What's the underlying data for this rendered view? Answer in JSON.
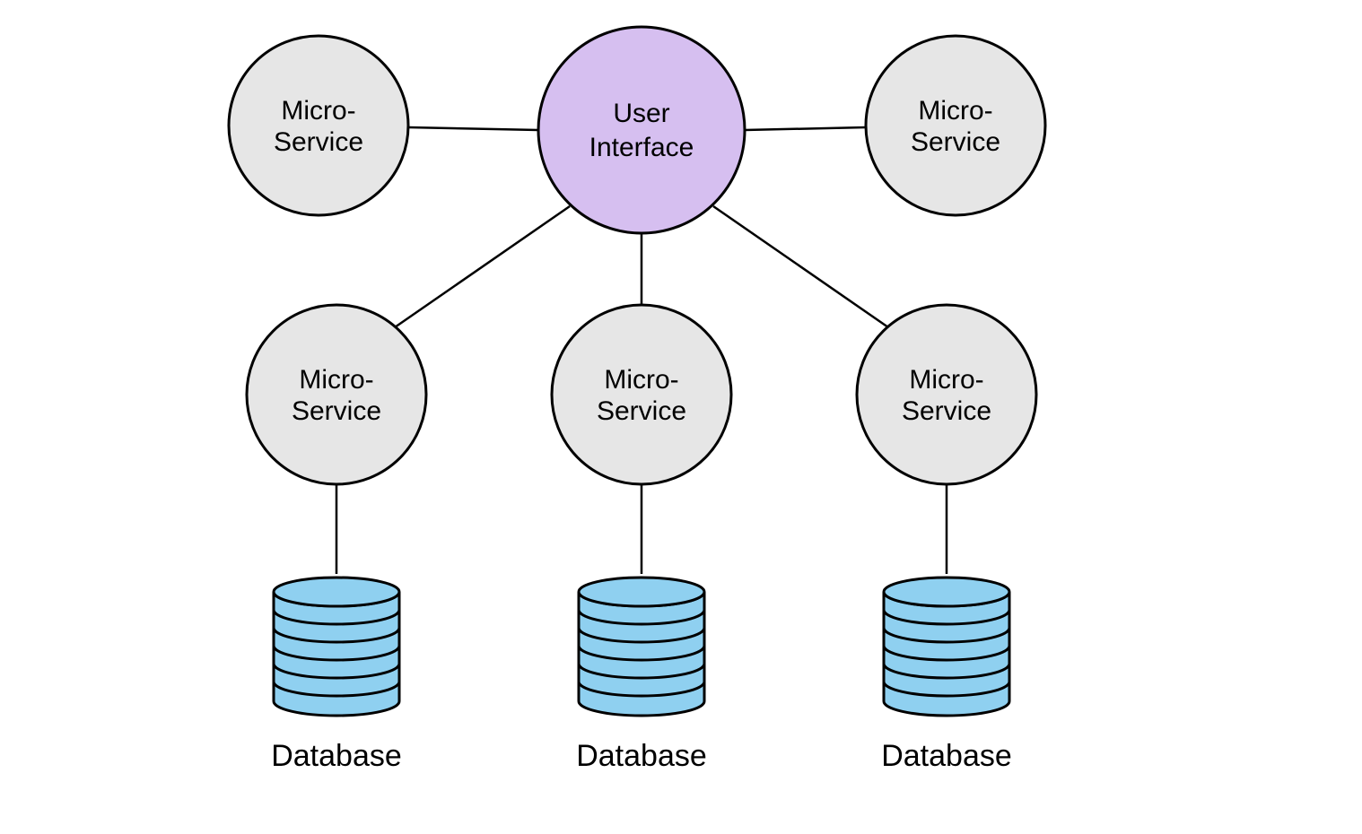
{
  "colors": {
    "circle_grey": "#e6e6e6",
    "circle_purple": "#d6bff0",
    "database_fill": "#8fd0f0"
  },
  "nodes": {
    "ui": {
      "line1": "User",
      "line2": "Interface"
    },
    "ms_top_left": {
      "line1": "Micro-",
      "line2": "Service"
    },
    "ms_top_right": {
      "line1": "Micro-",
      "line2": "Service"
    },
    "ms_bot_left": {
      "line1": "Micro-",
      "line2": "Service"
    },
    "ms_bot_mid": {
      "line1": "Micro-",
      "line2": "Service"
    },
    "ms_bot_right": {
      "line1": "Micro-",
      "line2": "Service"
    }
  },
  "databases": {
    "db_left": {
      "label": "Database"
    },
    "db_mid": {
      "label": "Database"
    },
    "db_right": {
      "label": "Database"
    }
  },
  "edges": [
    {
      "from": "ui",
      "to": "ms_top_left"
    },
    {
      "from": "ui",
      "to": "ms_top_right"
    },
    {
      "from": "ui",
      "to": "ms_bot_left"
    },
    {
      "from": "ui",
      "to": "ms_bot_mid"
    },
    {
      "from": "ui",
      "to": "ms_bot_right"
    },
    {
      "from": "ms_bot_left",
      "to": "db_left"
    },
    {
      "from": "ms_bot_mid",
      "to": "db_mid"
    },
    {
      "from": "ms_bot_right",
      "to": "db_right"
    }
  ]
}
